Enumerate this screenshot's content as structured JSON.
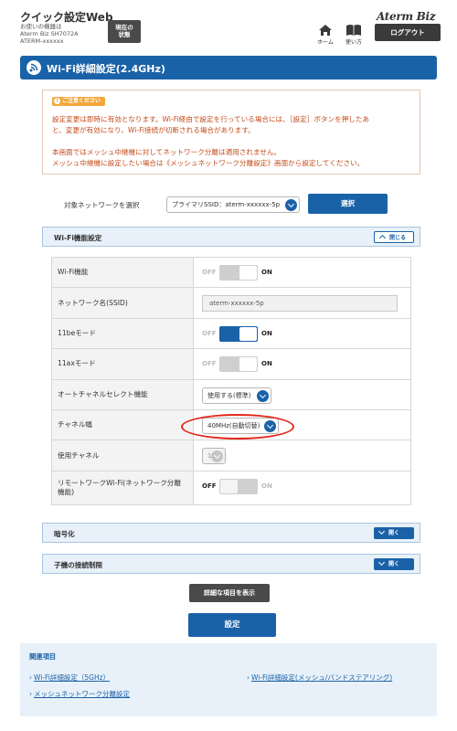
{
  "header": {
    "app_title": "クイック設定Web",
    "device_label": "お使いの機器は",
    "device_model": "Aterm Biz SH7072A",
    "device_name": "ATERM-xxxxxx",
    "status_line1": "現在の",
    "status_line2": "状態",
    "brand": "Aterm Biz",
    "home_label": "ホーム",
    "help_label": "使い方",
    "logout_label": "ログアウト"
  },
  "page": {
    "title": "Wi-Fi詳細設定(2.4GHz)"
  },
  "notice": {
    "tag": "ご注意ください",
    "line1": "設定変更は即時に有効となります。Wi-Fi経由で設定を行っている場合には、［設定］ボタンを押したあ",
    "line2": "と、変更が有効になり、Wi-Fi接続が切断される場合があります。",
    "line3": "本画面ではメッシュ中継機に対してネットワーク分離は適用されません。",
    "line4": "メッシュ中継機に設定したい場合は《メッシュネットワーク分離設定》画面から設定してください。"
  },
  "target": {
    "label": "対象ネットワークを選択",
    "selected": "プライマリSSID：aterm-xxxxxx-5p",
    "select_button": "選択"
  },
  "wifi_function_section": {
    "title": "Wi-Fi機能設定",
    "toggle_label": "閉じる"
  },
  "settings": {
    "wifi_function": {
      "label": "Wi-Fi機能",
      "off": "OFF",
      "on": "ON",
      "state": "on-disabled"
    },
    "ssid": {
      "label": "ネットワーク名(SSID)",
      "value": "aterm-xxxxxx-5p"
    },
    "mode_11be": {
      "label": "11beモード",
      "off": "OFF",
      "on": "ON",
      "state": "on"
    },
    "mode_11ax": {
      "label": "11axモード",
      "off": "OFF",
      "on": "ON",
      "state": "on-disabled"
    },
    "auto_channel": {
      "label": "オートチャネルセレクト機能",
      "value": "使用する(標準)"
    },
    "channel_width": {
      "label": "チャネル幅",
      "value": "40MHz(自動切替)"
    },
    "channel": {
      "label": "使用チャネル",
      "value": "1"
    },
    "remote_work": {
      "label": "リモートワークWi-Fi(ネットワーク分離機能)",
      "off": "OFF",
      "on": "ON",
      "state": "off"
    }
  },
  "encryption_section": {
    "title": "暗号化",
    "toggle_label": "開く"
  },
  "child_limit_section": {
    "title": "子機の接続制限",
    "toggle_label": "開く"
  },
  "buttons": {
    "show_details": "詳細な項目を表示",
    "apply": "設定"
  },
  "related": {
    "title": "関連項目",
    "link_5ghz": "Wi-Fi詳細設定（5GHz）",
    "link_mesh_band": "Wi-Fi詳細設定(メッシュ/バンドステアリング)",
    "link_mesh_sep": "メッシュネットワーク分離設定"
  },
  "colors": {
    "primary_blue": "#1a62a8",
    "notice_red": "#c64b1a",
    "highlight_ring": "#e5261a",
    "warning_orange": "#f3a83b"
  }
}
